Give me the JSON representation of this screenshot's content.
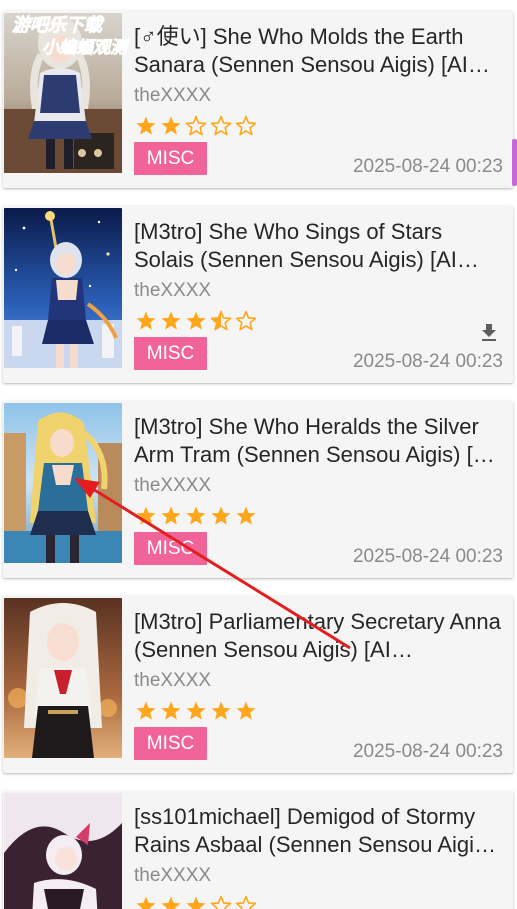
{
  "items": [
    {
      "title": "[♂使い] She Who Molds the Earth Sanara (Sennen Sensou Aigis) [AI Generated]",
      "uploader": "theXXXX",
      "rating": 2,
      "category": "MISC",
      "posted": "2025-08-24 00:23",
      "downloaded": false
    },
    {
      "title": "[M3tro] She Who Sings of Stars Solais (Sennen Sensou Aigis) [AI Generated]",
      "uploader": "theXXXX",
      "rating": 3.5,
      "category": "MISC",
      "posted": "2025-08-24 00:23",
      "downloaded": true
    },
    {
      "title": "[M3tro] She Who Heralds the Silver Arm Tram (Sennen Sensou Aigis) [AI Generated]",
      "uploader": "theXXXX",
      "rating": 5,
      "category": "MISC",
      "posted": "2025-08-24 00:23",
      "downloaded": false
    },
    {
      "title": "[M3tro] Parliamentary Secretary Anna (Sennen Sensou Aigis) [AI Generated]",
      "uploader": "theXXXX",
      "rating": 5,
      "category": "MISC",
      "posted": "2025-08-24 00:23",
      "downloaded": false
    },
    {
      "title": "[ss101michael] Demigod of Stormy Rains Asbaal (Sennen Sensou Aigis) [AI Generated]",
      "uploader": "theXXXX",
      "rating": 3,
      "category": "MISC",
      "posted": "2025-08-24 00:23",
      "downloaded": false
    }
  ],
  "watermark": {
    "line1": "游吧乐下载",
    "line2": "小蝙蝠观测"
  },
  "colors": {
    "star": "#ffa61a",
    "category_misc": "#f0649a",
    "card_bg": "#f5f5f5",
    "annotation_arrow": "#e41e1e",
    "scroll_indicator": "#c867d8"
  },
  "icons": {
    "download": "download-icon",
    "star_full": "star-full-icon",
    "star_half": "star-half-icon",
    "star_empty": "star-empty-icon"
  }
}
